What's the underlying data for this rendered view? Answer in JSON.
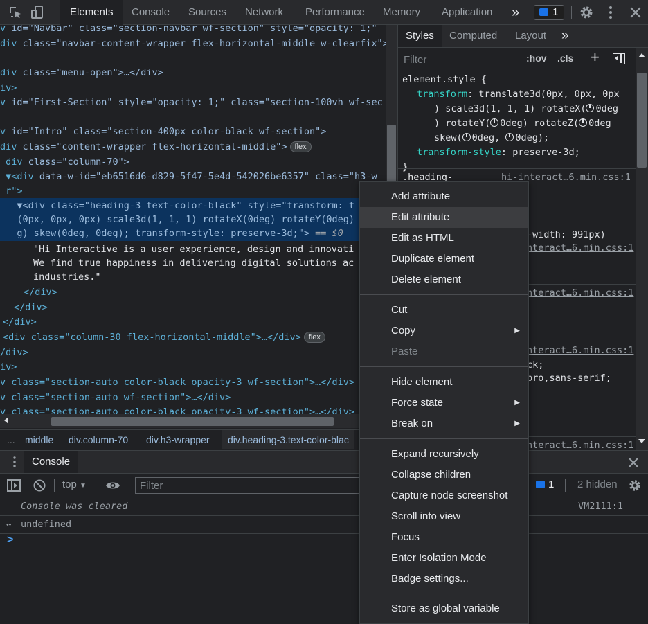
{
  "toolbar": {
    "tabs": [
      "Elements",
      "Console",
      "Sources",
      "Network",
      "Performance",
      "Memory",
      "Application"
    ],
    "more": "»",
    "issues_count": "1"
  },
  "dom_tree": {
    "lines": [
      {
        "open": "v ",
        "pre": "id=\"Navbar\" class=\"section-navbar wf-section\" style=\"opacity: 1;\"",
        "tail": ""
      },
      {
        "open": "div ",
        "pre": "class=\"navbar-content-wrapper flex-horizontal-middle w-clearfix\">",
        "tail": ""
      },
      {
        "open": "div ",
        "pre": "class=\"menu-open\">…</div>",
        "tail": ""
      },
      {
        "open": "iv>",
        "pre": "",
        "tail": ""
      },
      {
        "open": "v ",
        "pre": "id=\"First-Section\" style=\"opacity: 1;\" class=\"section-100vh wf-sec",
        "tail": ""
      },
      {
        "open": "v ",
        "pre": "id=\"Intro\" class=\"section-400px color-black wf-section\">",
        "tail": ""
      },
      {
        "open": "div ",
        "pre": "class=\"content-wrapper flex-horizontal-middle\">",
        "tail": ""
      },
      {
        "open": " div ",
        "pre": "class=\"column-70\">",
        "tail": ""
      },
      {
        "open": " ▼<div ",
        "pre": "data-w-id=\"eb6516d6-d829-5f47-5e4d-542026be6357\" class=\"h3-w",
        "tail": ""
      },
      {
        "open": " r\">",
        "pre": "",
        "tail": ""
      }
    ],
    "selected": [
      "   ▼<div class=\"heading-3 text-color-black\" style=\"transform: t",
      "   (0px, 0px, 0px) scale3d(1, 1, 1) rotateX(0deg) rotateY(0deg)",
      "   g) skew(0deg, 0deg); transform-style: preserve-3d;\">"
    ],
    "selected_marker": "== $0",
    "text_lines": [
      "\"Hi Interactive is a user experience, design and innovati",
      "We find true happiness in delivering digital solutions ac",
      "industries.\""
    ],
    "closing": [
      "</div>",
      "</div>",
      "</div>"
    ],
    "after": [
      "<div class=\"column-30 flex-horizontal-middle\">…</div>",
      "/div>",
      "iv>",
      "v class=\"section-auto color-black opacity-3 wf-section\">…</div>",
      "v class=\"section-auto wf-section\">…</div>",
      "v class=\"section-auto color-black opacity-3 wf-section\">…</div>"
    ],
    "badge": "flex"
  },
  "breadcrumb": [
    "...",
    "middle",
    "div.column-70",
    "div.h3-wrapper",
    "div.heading-3.text-color-blac"
  ],
  "styles_pane": {
    "tabs": [
      "Styles",
      "Computed",
      "Layout"
    ],
    "more": "»",
    "filter_placeholder": "Filter",
    "hov": ":hov",
    "cls": ".cls",
    "plus": "+",
    "rule_selector": "element.style {",
    "prop1": "transform",
    "val1a": "translate3d(0px, 0px, 0px",
    "val1b": ") scale3d(1, 1, 1) rotateX(",
    "val1b_end": "0deg",
    "val1c": ") rotateY(",
    "val1c_mid": "0deg) rotateZ(",
    "val1c_end": "0deg",
    "val1d": "skew(",
    "val1d_mid": "0deg, ",
    "val1d_end": "0deg);",
    "prop2": "transform-style",
    "val2": "preserve-3d;",
    "close": "}",
    "rule2_selector": ".heading-",
    "rule2_src": "hi-interact…6.min.css:1",
    "media": "-width: 991px)",
    "src2": "nteract…6.min.css:1",
    "src3": "nteract…6.min.css:1",
    "src4": "nteract…6.min.css:1",
    "frag1": "ck;",
    "frag2": "pro,sans-serif;",
    "src5": "nteract…6.min.css:1"
  },
  "drawer": {
    "tab": "Console",
    "context": "top",
    "filter_placeholder": "Filter",
    "issues": "1",
    "hidden": "2 hidden",
    "messages": [
      {
        "text": "Console was cleared",
        "source": "VM2111:1"
      },
      {
        "text": "undefined",
        "source": ""
      }
    ],
    "prompt": ">"
  },
  "context_menu": {
    "groups": [
      [
        {
          "label": "Add attribute"
        },
        {
          "label": "Edit attribute",
          "highlighted": true
        },
        {
          "label": "Edit as HTML"
        },
        {
          "label": "Duplicate element"
        },
        {
          "label": "Delete element"
        }
      ],
      [
        {
          "label": "Cut"
        },
        {
          "label": "Copy",
          "submenu": true
        },
        {
          "label": "Paste",
          "disabled": true
        }
      ],
      [
        {
          "label": "Hide element"
        },
        {
          "label": "Force state",
          "submenu": true
        },
        {
          "label": "Break on",
          "submenu": true
        }
      ],
      [
        {
          "label": "Expand recursively"
        },
        {
          "label": "Collapse children"
        },
        {
          "label": "Capture node screenshot"
        },
        {
          "label": "Scroll into view"
        },
        {
          "label": "Focus"
        },
        {
          "label": "Enter Isolation Mode"
        },
        {
          "label": "Badge settings..."
        }
      ],
      [
        {
          "label": "Store as global variable"
        }
      ]
    ]
  }
}
